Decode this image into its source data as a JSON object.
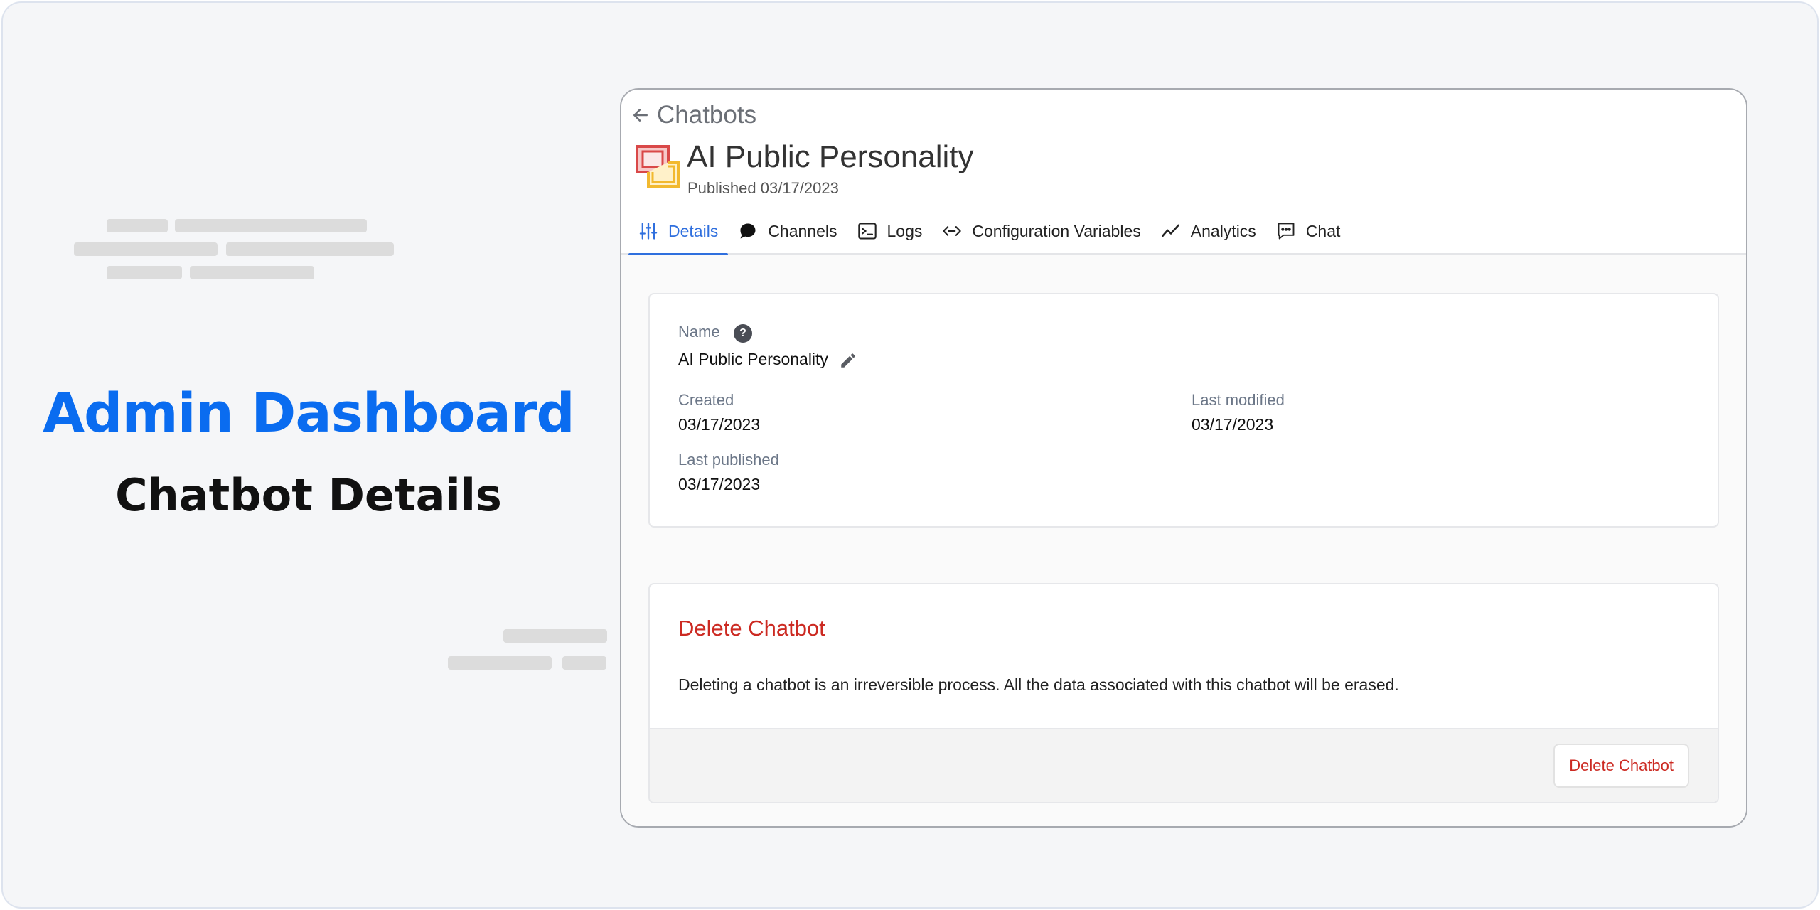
{
  "hero": {
    "title": "Admin Dashboard",
    "subtitle": "Chatbot Details"
  },
  "breadcrumb": {
    "back_label": "Chatbots"
  },
  "bot": {
    "title": "AI Public Personality",
    "published": "Published 03/17/2023"
  },
  "tabs": [
    {
      "label": "Details",
      "icon": "sliders-icon",
      "active": true
    },
    {
      "label": "Channels",
      "icon": "chat-bubbles-icon",
      "active": false
    },
    {
      "label": "Logs",
      "icon": "terminal-icon",
      "active": false
    },
    {
      "label": "Configuration Variables",
      "icon": "code-arrows-icon",
      "active": false
    },
    {
      "label": "Analytics",
      "icon": "trend-line-icon",
      "active": false
    },
    {
      "label": "Chat",
      "icon": "chat-dots-icon",
      "active": false
    }
  ],
  "details": {
    "name_label": "Name",
    "name_value": "AI Public Personality",
    "created_label": "Created",
    "created_value": "03/17/2023",
    "modified_label": "Last modified",
    "modified_value": "03/17/2023",
    "published_label": "Last published",
    "published_value": "03/17/2023"
  },
  "danger": {
    "title": "Delete Chatbot",
    "description": "Deleting a chatbot is an irreversible process. All the data associated with this chatbot will be erased.",
    "button_label": "Delete Chatbot"
  },
  "colors": {
    "accent": "#2f6fde",
    "hero_blue": "#0a6cf0",
    "danger": "#cc2a22",
    "logo_red": "#d94848",
    "logo_yellow": "#f2b92f"
  }
}
